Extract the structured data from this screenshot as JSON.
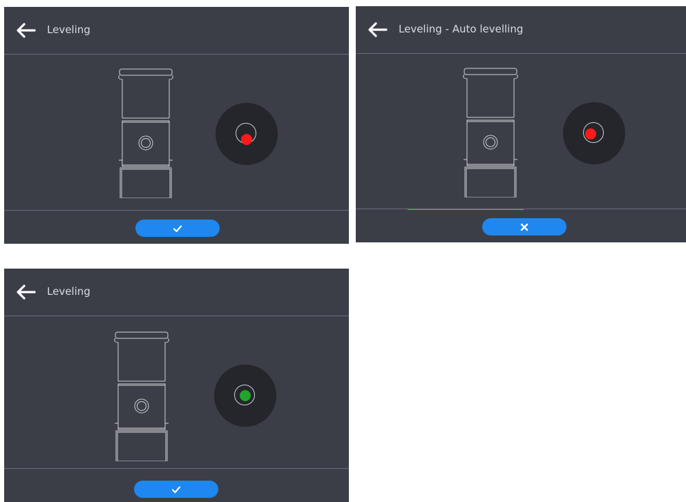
{
  "panels": [
    {
      "id": "panel-1",
      "title": "Leveling",
      "back_icon": "arrow-left-icon",
      "bubble_color": "#ff1a1a",
      "bubble_state": "off-level",
      "action_icon": "checkmark-icon",
      "progress_visible": false
    },
    {
      "id": "panel-2",
      "title": "Leveling - Auto levelling",
      "back_icon": "arrow-left-icon",
      "bubble_color": "#ff1a1a",
      "bubble_state": "near-level",
      "action_icon": "close-icon",
      "progress_visible": true
    },
    {
      "id": "panel-3",
      "title": "Leveling",
      "back_icon": "arrow-left-icon",
      "bubble_color": "#1fa52b",
      "bubble_state": "level",
      "action_icon": "checkmark-icon",
      "progress_visible": false
    }
  ],
  "colors": {
    "panel_bg": "#3b3e47",
    "disc_bg": "#24262c",
    "accent_blue": "#1e88f0",
    "progress_green": "#3ec24a",
    "text": "#d9dbe0"
  }
}
